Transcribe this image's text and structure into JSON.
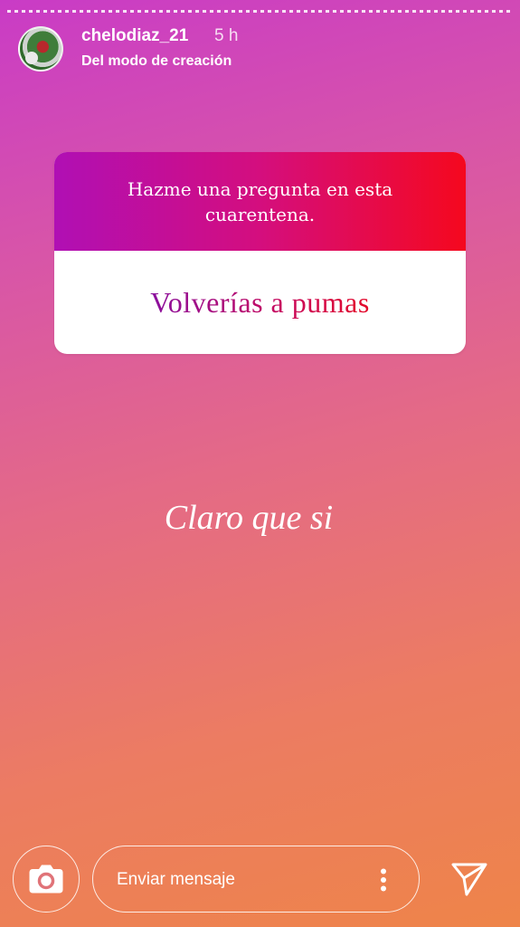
{
  "story": {
    "username": "chelodiaz_21",
    "time": "5 h",
    "subtitle": "Del modo de creación",
    "avatar_icon": "profile-photo"
  },
  "question_sticker": {
    "prompt": "Hazme una pregunta en esta cuarentena.",
    "question": "Volverías a pumas"
  },
  "answer_text": "Claro que si",
  "footer": {
    "camera_icon": "camera-icon",
    "message_placeholder": "Enviar mensaje",
    "more_icon": "more-vertical-icon",
    "send_icon": "send-icon"
  },
  "colors": {
    "gradient_top": "#c93bc6",
    "gradient_bottom": "#ee8449",
    "sticker_header_start": "#b00fb4",
    "sticker_header_end": "#f5081e"
  }
}
